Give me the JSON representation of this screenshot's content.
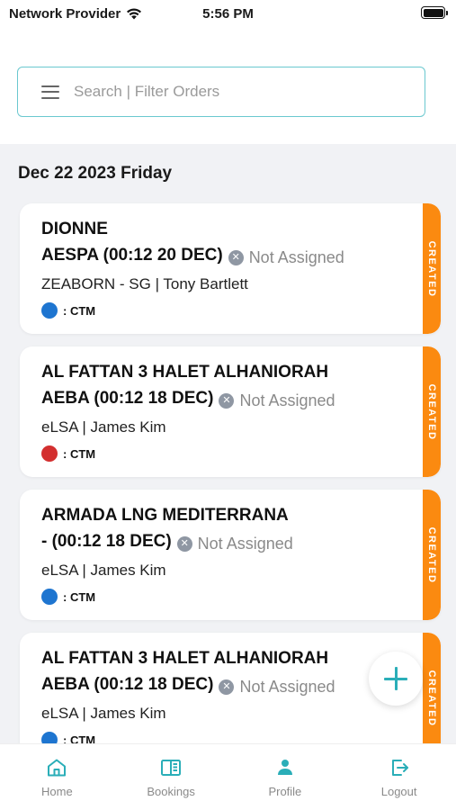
{
  "status_bar": {
    "carrier": "Network Provider",
    "time": "5:56 PM"
  },
  "search": {
    "placeholder": "Search | Filter Orders"
  },
  "date_header": "Dec 22 2023 Friday",
  "orders": [
    {
      "title_line1": "DIONNE",
      "title_line2": "AESPA (00:12 20 DEC)",
      "assignment": "Not Assigned",
      "subtitle": "ZEABORN - SG | Tony Bartlett",
      "type_label": ": CTM",
      "dot_color": "#1e75d0",
      "status": "CREATED"
    },
    {
      "title_line1": "AL FATTAN 3 HALET ALHANIORAH",
      "title_line2": "AEBA (00:12 18 DEC)",
      "assignment": "Not Assigned",
      "subtitle": "eLSA | James Kim",
      "type_label": ": CTM",
      "dot_color": "#d32f2f",
      "status": "CREATED"
    },
    {
      "title_line1": "ARMADA LNG MEDITERRANA",
      "title_line2": "- (00:12 18 DEC)",
      "assignment": "Not Assigned",
      "subtitle": "eLSA | James Kim",
      "type_label": ": CTM",
      "dot_color": "#1e75d0",
      "status": "CREATED"
    },
    {
      "title_line1": "AL FATTAN 3 HALET ALHANIORAH",
      "title_line2": "AEBA (00:12 18 DEC)",
      "assignment": "Not Assigned",
      "subtitle": "eLSA | James Kim",
      "type_label": ": CTM",
      "dot_color": "#1e75d0",
      "status": "CREATED"
    }
  ],
  "tabs": [
    {
      "label": "Home",
      "icon": "home-icon",
      "active": true
    },
    {
      "label": "Bookings",
      "icon": "book-icon",
      "active": false
    },
    {
      "label": "Profile",
      "icon": "person-icon",
      "active": false
    },
    {
      "label": "Logout",
      "icon": "logout-icon",
      "active": false
    }
  ],
  "colors": {
    "accent": "#2aaeb8",
    "status_created": "#fb8a10",
    "search_border": "#6ac8cf"
  }
}
